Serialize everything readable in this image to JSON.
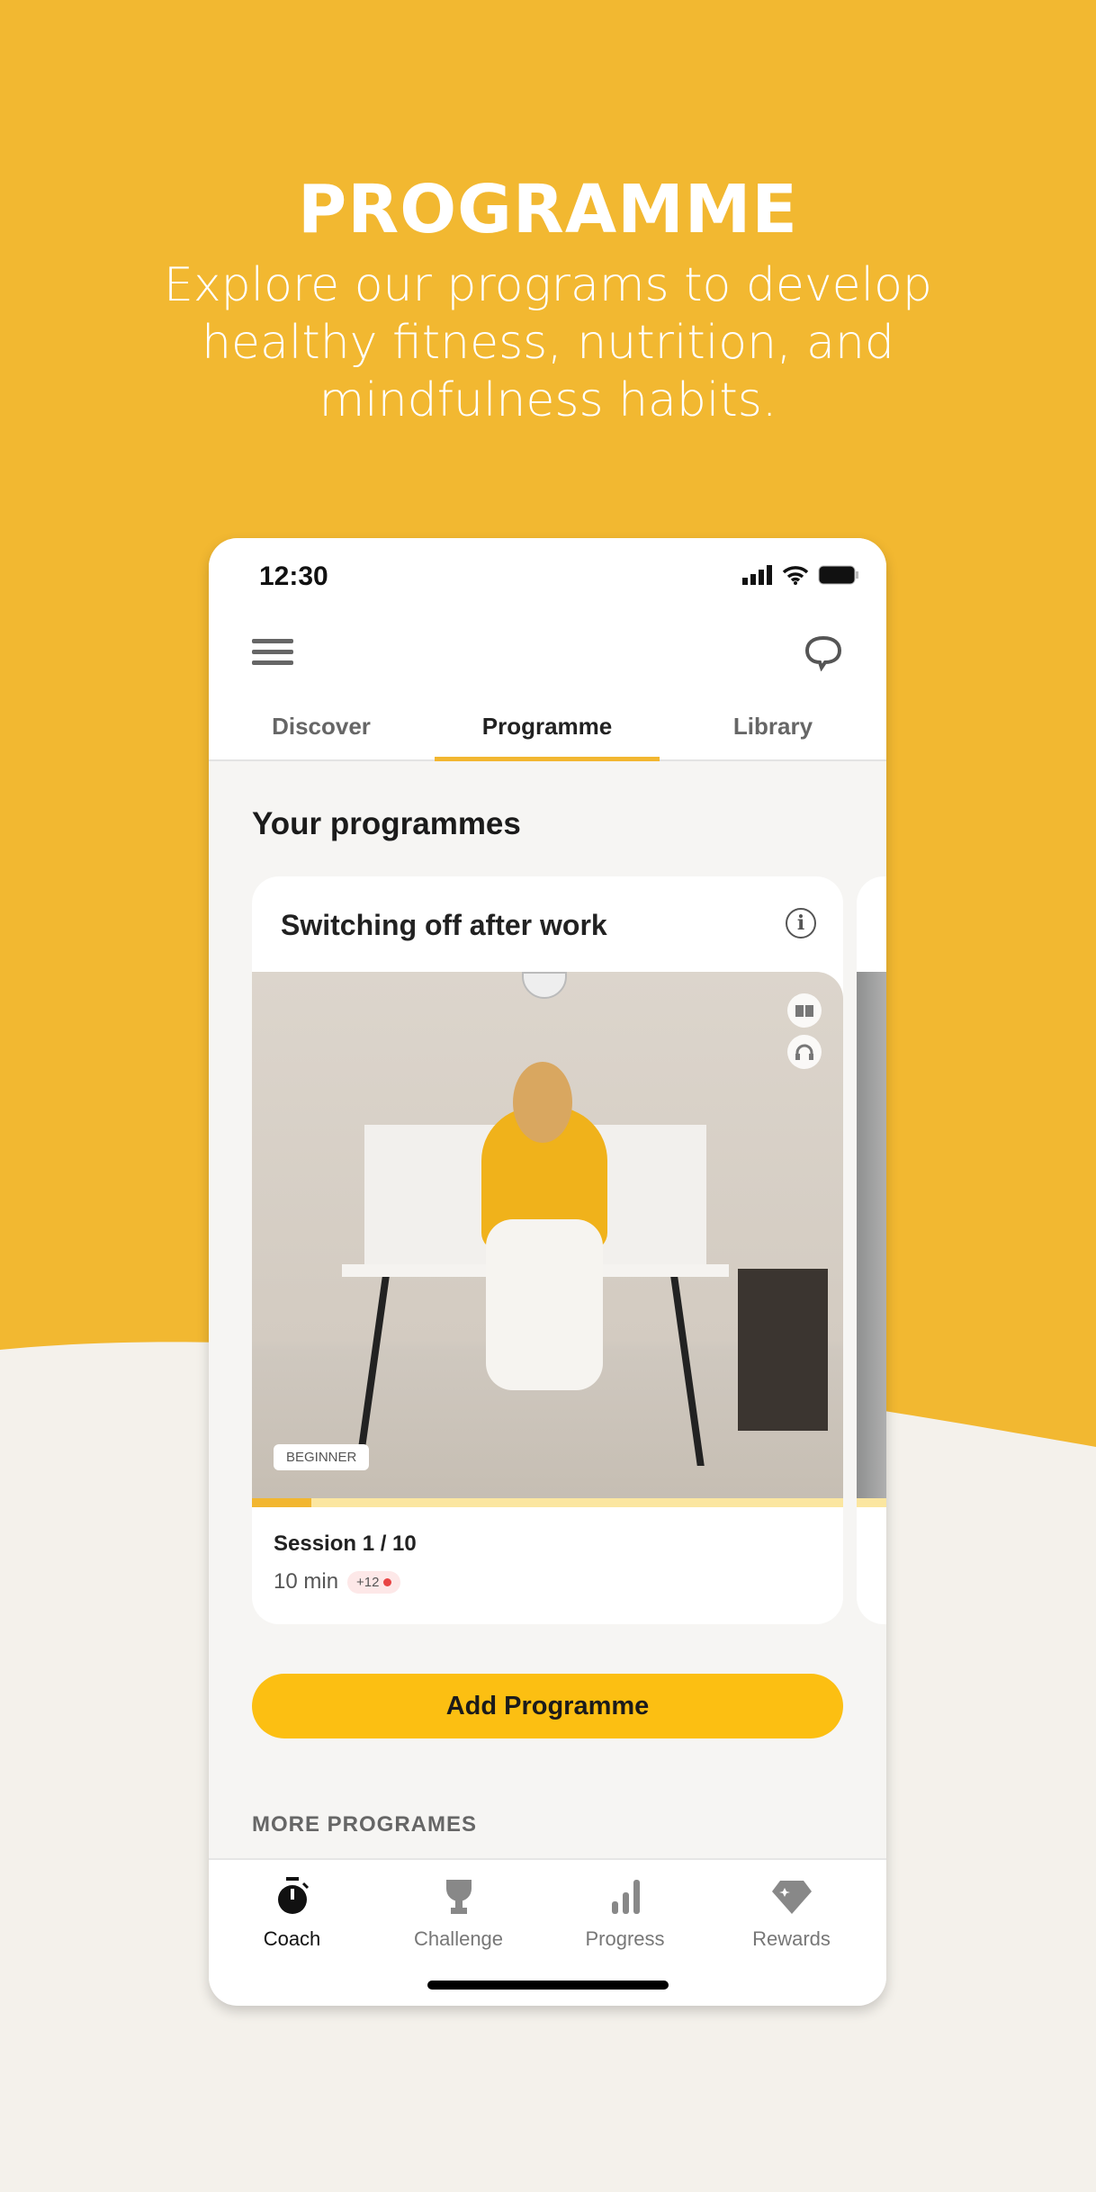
{
  "hero": {
    "title": "PROGRAMME",
    "subtitle": "Explore our programs to develop healthy fitness, nutrition, and mindfulness habits."
  },
  "colors": {
    "brand_yellow": "#f2b630",
    "button": "#fcbf12",
    "background": "#f4f1eb"
  },
  "status": {
    "time": "12:30"
  },
  "tabs": [
    {
      "label": "Discover"
    },
    {
      "label": "Programme",
      "active": true
    },
    {
      "label": "Library"
    }
  ],
  "section_title": "Your programmes",
  "card": {
    "title": "Switching off after work",
    "level": "BEGINNER",
    "progress": 0.1,
    "session": "Session 1 / 10",
    "duration": "10 min",
    "badge": "+12",
    "icons": [
      "book-icon",
      "headphones-icon"
    ]
  },
  "add_button": "Add Programme",
  "more_title": "MORE PROGRAMES",
  "nav": [
    {
      "label": "Coach",
      "icon": "stopwatch-icon",
      "active": true
    },
    {
      "label": "Challenge",
      "icon": "trophy-icon"
    },
    {
      "label": "Progress",
      "icon": "bar-chart-icon"
    },
    {
      "label": "Rewards",
      "icon": "diamond-icon"
    }
  ]
}
